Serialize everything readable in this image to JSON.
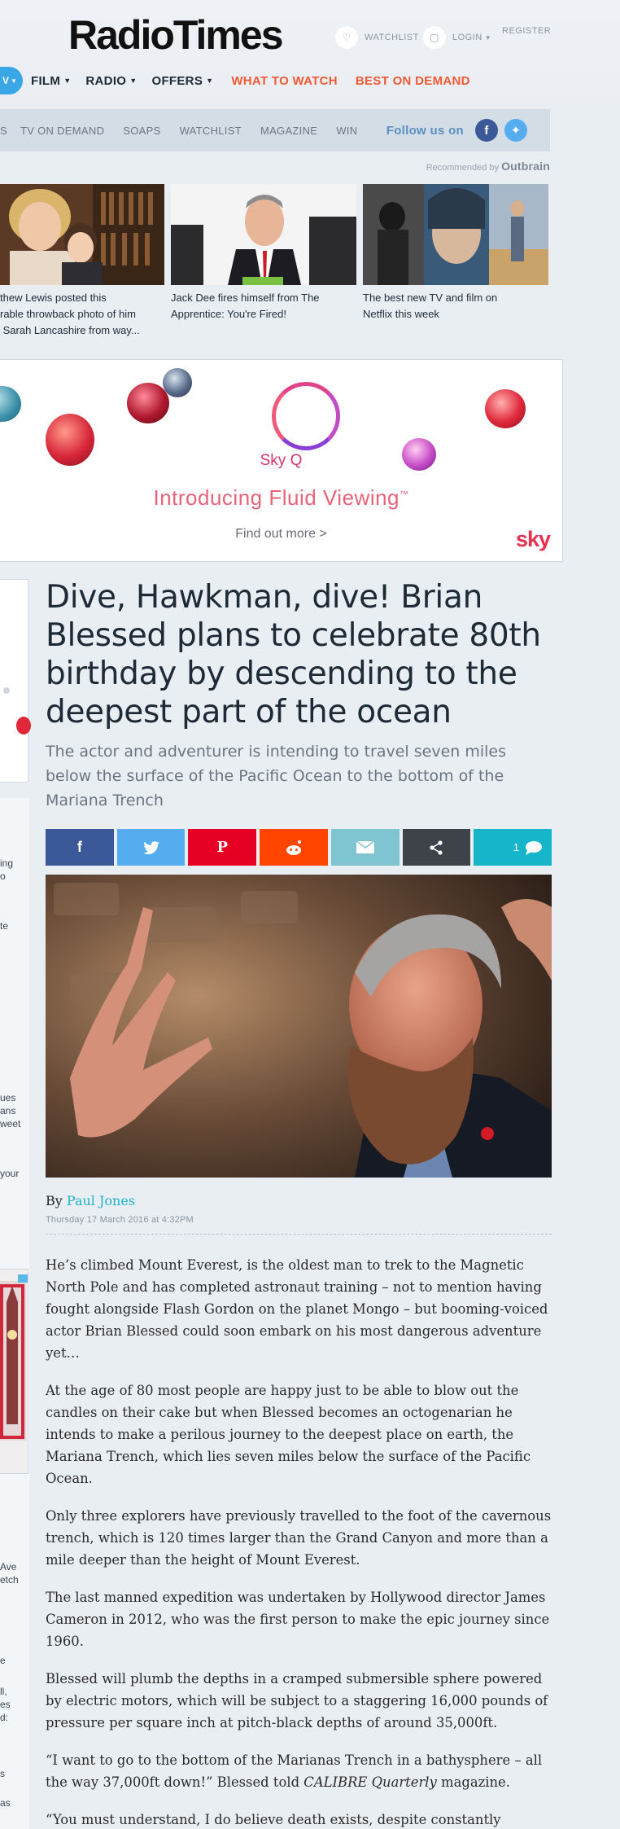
{
  "header": {
    "logo": "RadioTimes",
    "watchlist": "WATCHLIST",
    "login": "LOGIN",
    "register": "REGISTER"
  },
  "mainnav": {
    "tv": "V",
    "items": [
      "FILM",
      "RADIO",
      "OFFERS"
    ],
    "what_to_watch": "WHAT TO WATCH",
    "best_on_demand": "BEST ON DEMAND"
  },
  "subnav": {
    "items": [
      "S",
      "TV ON DEMAND",
      "SOAPS",
      "WATCHLIST",
      "MAGAZINE",
      "WIN"
    ],
    "follow": "Follow us on"
  },
  "recommended": {
    "label": "Recommended by",
    "brand": "Outbrain"
  },
  "teasers": [
    {
      "caption": "thew Lewis posted this\nrable throwback photo of him\n Sarah Lancashire from way..."
    },
    {
      "caption": "Jack Dee fires himself from The\nApprentice: You're Fired!"
    },
    {
      "caption": "The best new TV and film on\nNetflix this week"
    }
  ],
  "ad": {
    "product": "Sky Q",
    "tagline": "Introducing Fluid Viewing",
    "tm": "™",
    "cta": "Find out more >",
    "brand": "sky"
  },
  "leftcol": {
    "frags": [
      "ing\no",
      "te",
      "ues\nans\nweet",
      "your",
      "Ave\netch",
      "e",
      "ll,\nes\nd:",
      "s",
      "as"
    ]
  },
  "article": {
    "headline": "Dive, Hawkman, dive! Brian Blessed plans to celebrate 80th birthday by descending to the deepest part of the ocean",
    "standfirst": "The actor and adventurer is intending to travel seven miles below the surface of the Pacific Ocean to the bottom of the Mariana Trench",
    "comments_count": "1",
    "by": "By",
    "author": "Paul Jones",
    "date": "Thursday 17 March 2016 at 4:32PM",
    "paragraphs": [
      "He’s climbed Mount Everest, is the oldest man to trek to the Magnetic North Pole and has completed astronaut training – not to mention having fought alongside Flash Gordon on the planet Mongo – but booming-voiced actor Brian Blessed could soon embark on his most dangerous adventure yet…",
      "At the age of 80 most people are happy just to be able to blow out the candles on their cake but when Blessed becomes an octogenarian he intends to make a perilous journey to the deepest place on earth, the Mariana Trench, which lies seven miles below the surface of the Pacific Ocean.",
      "Only three explorers have previously travelled to the foot of the cavernous trench, which is 120 times larger than the Grand Canyon and more than a mile deeper than the height of Mount Everest.",
      "The last manned expedition was undertaken by Hollywood director James Cameron in 2012, who was the first person to make the epic journey since 1960.",
      "Blessed will plumb the depths in a cramped submersible sphere powered by electric motors, which will be subject to a staggering 16,000 pounds of pressure per square inch at pitch-black depths of around 35,000ft.",
      "“You must understand, I do believe death exists, despite constantly defying it. But I live out on a limb.”"
    ],
    "quote": {
      "pre": "“I want to go to the bottom of the Marianas Trench in a bathysphere – all the way 37,000ft down!” Blessed told ",
      "mag": "CALIBRE Quarterly",
      "post": " magazine."
    }
  },
  "colors": {
    "accent": "#39a7e6",
    "hot": "#ef5a33",
    "facebook": "#3b5998",
    "twitter": "#55acee",
    "pinterest": "#e60023",
    "reddit": "#ff4500",
    "email": "#7fc4d1",
    "share": "#3d4348",
    "comments": "#17b5c9"
  }
}
